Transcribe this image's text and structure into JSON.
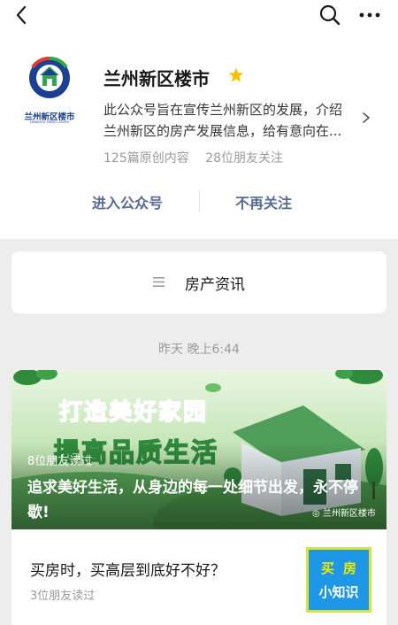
{
  "header": {
    "back_icon": "back-chevron-icon",
    "search_icon": "search-icon",
    "more_icon": "more-dots-icon"
  },
  "account": {
    "logo_text": "兰州新区楼市",
    "logo_subtext": "LANZHOU XINQU LOUSHI",
    "name": "兰州新区楼市",
    "badge_icon": "star-icon",
    "description_line1": "此公众号旨在宣传兰州新区的发展，介绍",
    "description_line2": "兰州新区的房产发展信息，给有意向在...",
    "original_count": "125篇原创内容",
    "friends_following": "28位朋友关注"
  },
  "actions": {
    "enter_label": "进入公众号",
    "unfollow_label": "不再关注"
  },
  "menu": {
    "icon": "menu-lines-icon",
    "label": "房产资讯"
  },
  "feed": {
    "timestamp": "昨天 晚上6:44",
    "headline": {
      "banner_line1": "打造美好家园",
      "banner_line2": "提高品质生活",
      "readers": "8位朋友读过",
      "title": "追求美好生活，从身边的每一处细节出发，永不停歇!",
      "watermark": "兰州新区楼市"
    },
    "item": {
      "title": "买房时，买高层到底好不好？",
      "readers": "3位朋友读过",
      "thumb_line1": "买房",
      "thumb_line2": "小知识"
    }
  },
  "colors": {
    "link_blue": "#576b95",
    "banner_green": "#3faa5a",
    "title_yellow": "#e8df1c",
    "star_gold": "#f4c400"
  }
}
